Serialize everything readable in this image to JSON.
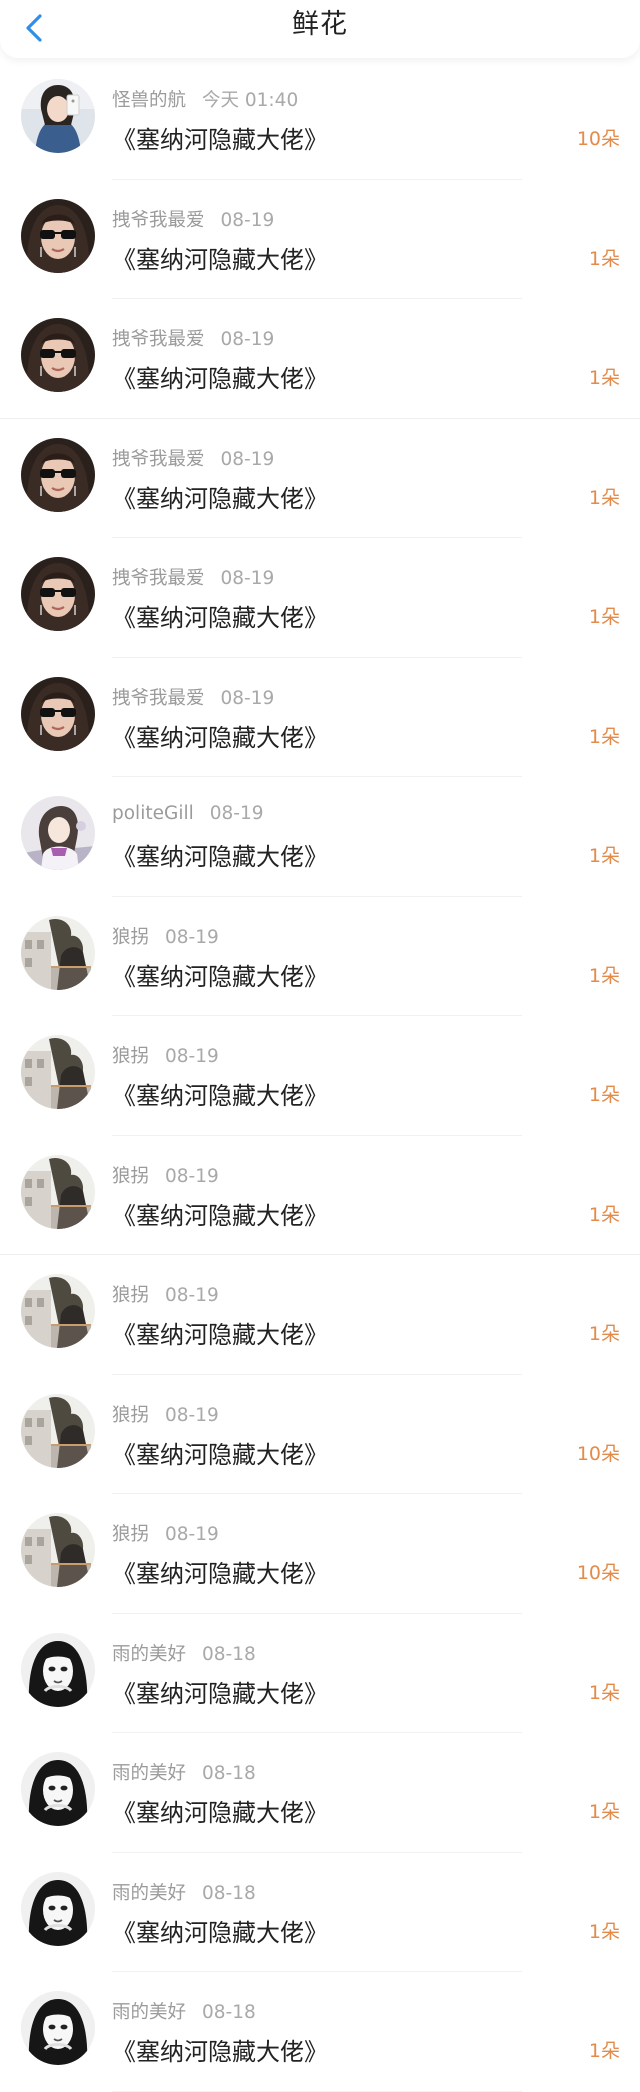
{
  "header": {
    "title": "鲜花",
    "back_icon": "chevron-left-icon",
    "accent": "#2f8fe6"
  },
  "colors": {
    "count": "#e38b4a",
    "name": "#9b9b9b",
    "book": "#222222"
  },
  "items": [
    {
      "user": "怪兽的航",
      "time": "今天 01:40",
      "book": "《塞纳河隐藏大佬》",
      "count": "10朵",
      "avatar": "selfie-girl"
    },
    {
      "user": "拽爷我最爱",
      "time": "08-19",
      "book": "《塞纳河隐藏大佬》",
      "count": "1朵",
      "avatar": "sunglasses-girl"
    },
    {
      "user": "拽爷我最爱",
      "time": "08-19",
      "book": "《塞纳河隐藏大佬》",
      "count": "1朵",
      "avatar": "sunglasses-girl"
    },
    {
      "user": "拽爷我最爱",
      "time": "08-19",
      "book": "《塞纳河隐藏大佬》",
      "count": "1朵",
      "avatar": "sunglasses-girl"
    },
    {
      "user": "拽爷我最爱",
      "time": "08-19",
      "book": "《塞纳河隐藏大佬》",
      "count": "1朵",
      "avatar": "sunglasses-girl"
    },
    {
      "user": "拽爷我最爱",
      "time": "08-19",
      "book": "《塞纳河隐藏大佬》",
      "count": "1朵",
      "avatar": "sunglasses-girl"
    },
    {
      "user": "politeGill",
      "time": "08-19",
      "book": "《塞纳河隐藏大佬》",
      "count": "1朵",
      "avatar": "anime-girl"
    },
    {
      "user": "狼拐",
      "time": "08-19",
      "book": "《塞纳河隐藏大佬》",
      "count": "1朵",
      "avatar": "street-scene"
    },
    {
      "user": "狼拐",
      "time": "08-19",
      "book": "《塞纳河隐藏大佬》",
      "count": "1朵",
      "avatar": "street-scene"
    },
    {
      "user": "狼拐",
      "time": "08-19",
      "book": "《塞纳河隐藏大佬》",
      "count": "1朵",
      "avatar": "street-scene"
    },
    {
      "user": "狼拐",
      "time": "08-19",
      "book": "《塞纳河隐藏大佬》",
      "count": "1朵",
      "avatar": "street-scene"
    },
    {
      "user": "狼拐",
      "time": "08-19",
      "book": "《塞纳河隐藏大佬》",
      "count": "10朵",
      "avatar": "street-scene"
    },
    {
      "user": "狼拐",
      "time": "08-19",
      "book": "《塞纳河隐藏大佬》",
      "count": "10朵",
      "avatar": "street-scene"
    },
    {
      "user": "雨的美好",
      "time": "08-18",
      "book": "《塞纳河隐藏大佬》",
      "count": "1朵",
      "avatar": "bw-portrait"
    },
    {
      "user": "雨的美好",
      "time": "08-18",
      "book": "《塞纳河隐藏大佬》",
      "count": "1朵",
      "avatar": "bw-portrait"
    },
    {
      "user": "雨的美好",
      "time": "08-18",
      "book": "《塞纳河隐藏大佬》",
      "count": "1朵",
      "avatar": "bw-portrait"
    },
    {
      "user": "雨的美好",
      "time": "08-18",
      "book": "《塞纳河隐藏大佬》",
      "count": "1朵",
      "avatar": "bw-portrait"
    }
  ]
}
